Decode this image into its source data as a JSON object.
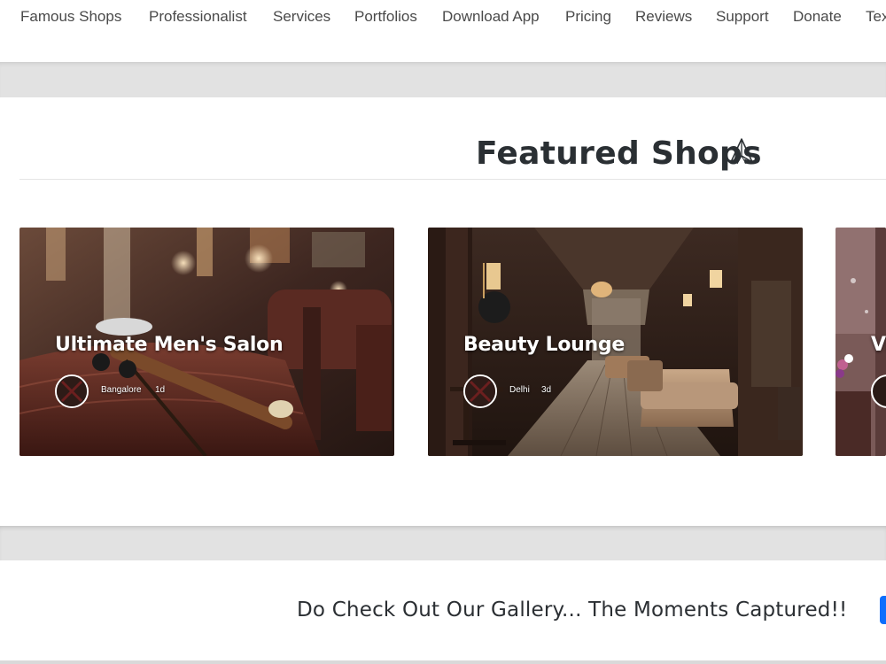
{
  "nav": {
    "items": [
      "Famous Shops",
      "Professionalist",
      "Services",
      "Portfolios",
      "Download App",
      "Pricing",
      "Reviews",
      "Support",
      "Donate",
      "Tex"
    ]
  },
  "featured": {
    "title": "Featured Shops",
    "icon": "paper-plane-icon"
  },
  "cards": [
    {
      "title": "Ultimate Men's Salon",
      "location": "Bangalore",
      "time": "1d"
    },
    {
      "title": "Beauty Lounge",
      "location": "Delhi",
      "time": "3d"
    },
    {
      "title": "Vi",
      "location": "",
      "time": ""
    }
  ],
  "gallery": {
    "text": "Do Check Out Our Gallery... The Moments Captured!!"
  },
  "colors": {
    "accent": "#0d6efd",
    "band": "#e2e2e2",
    "nav_text": "#4a4a4a"
  }
}
